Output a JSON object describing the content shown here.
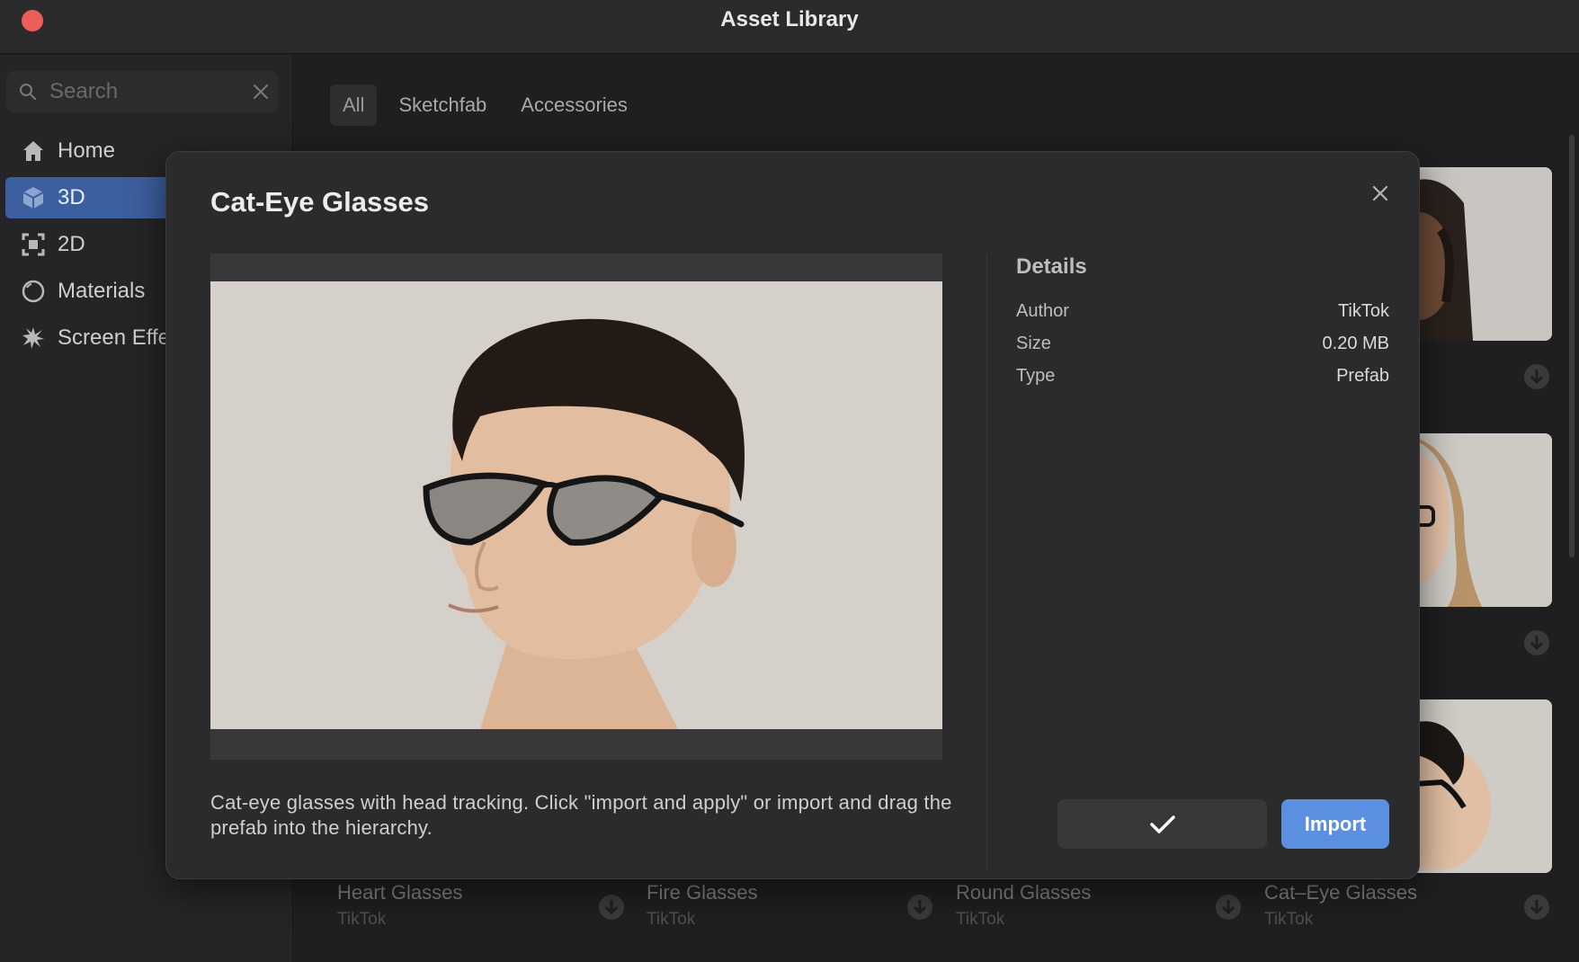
{
  "window": {
    "title": "Asset Library"
  },
  "sidebar": {
    "search_placeholder": "Search",
    "items": [
      {
        "label": "Home",
        "icon": "home-icon",
        "active": false
      },
      {
        "label": "3D",
        "icon": "cube-icon",
        "active": true
      },
      {
        "label": "2D",
        "icon": "frame-icon",
        "active": false
      },
      {
        "label": "Materials",
        "icon": "circle-icon",
        "active": false
      },
      {
        "label": "Screen Effe",
        "icon": "burst-icon",
        "active": false
      }
    ]
  },
  "tabs": [
    "All",
    "Sketchfab",
    "Accessories"
  ],
  "cards": [
    {
      "name": "Heart Glasses",
      "author": "TikTok"
    },
    {
      "name": "Fire Glasses",
      "author": "TikTok"
    },
    {
      "name": "Round Glasses",
      "author": "TikTok"
    },
    {
      "name": "Cat–Eye Glasses",
      "author": "TikTok"
    }
  ],
  "modal": {
    "title": "Cat-Eye Glasses",
    "description": "Cat-eye glasses with head tracking. Click \"import and apply\" or import and drag the prefab into the hierarchy.",
    "details_title": "Details",
    "details": [
      {
        "key": "Author",
        "value": "TikTok"
      },
      {
        "key": "Size",
        "value": "0.20 MB"
      },
      {
        "key": "Type",
        "value": "Prefab"
      }
    ],
    "import_label": "Import"
  },
  "colors": {
    "accent": "#5b8fe0",
    "active_nav": "#3c5f9f",
    "close_dot": "#ec5f56"
  }
}
